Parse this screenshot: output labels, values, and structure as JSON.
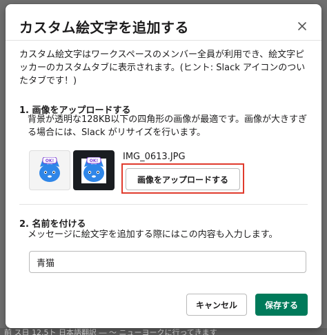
{
  "dialog": {
    "title": "カスタム絵文字を追加する",
    "intro": "カスタム絵文字はワークスペースのメンバー全員が利用でき、絵文字ピッカーのカスタムタブに表示されます。(ヒント: Slack アイコンのついたタブです！)"
  },
  "upload_section": {
    "heading": "1. 画像をアップロードする",
    "description": "背景が透明な128KB以下の四角形の画像が最適です。画像が大きすぎる場合には、Slack がリサイズを行います。",
    "file_name": "IMG_0613.JPG",
    "upload_button_label": "画像をアップロードする",
    "preview_badge": "OK!"
  },
  "name_section": {
    "heading": "2. 名前を付ける",
    "description": "メッセージに絵文字を追加する際にはこの内容も入力します。",
    "name_value": "青猫"
  },
  "footer": {
    "cancel_label": "キャンセル",
    "save_label": "保存する"
  },
  "background": {
    "partial_text": "前 ス日 12.5ト 日本語翻訳 ― ～ ニューヨークに行ってきます"
  },
  "colors": {
    "primary_button": "#007a5a",
    "highlight": "#e03a2c",
    "cat_blue": "#2f86e8",
    "badge_purple": "#7b3fd4"
  }
}
